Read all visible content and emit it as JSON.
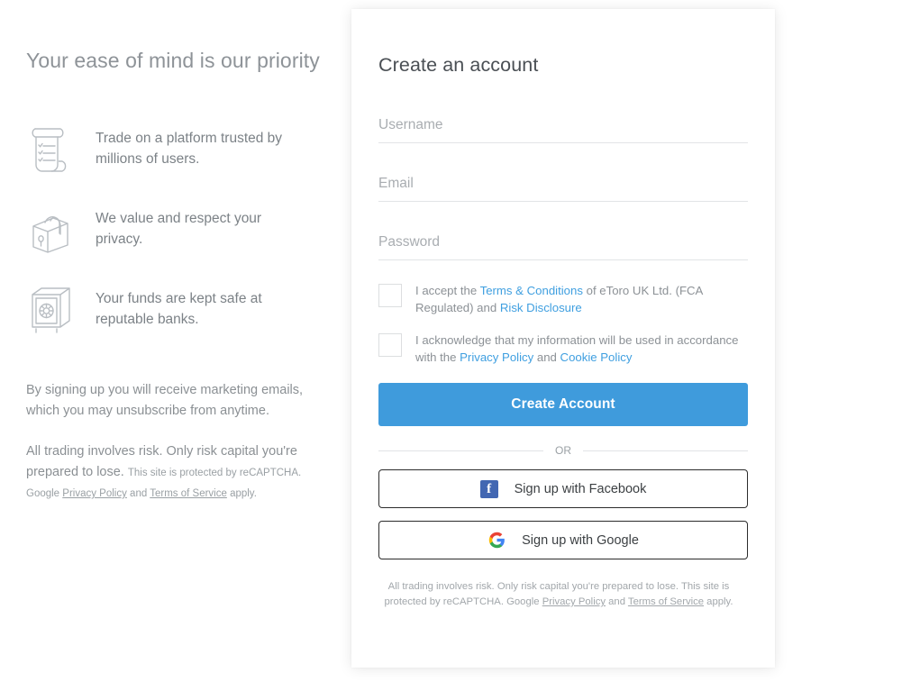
{
  "left": {
    "title": "Your ease of mind is our priority",
    "features": [
      {
        "icon": "scroll-checklist-icon",
        "text": "Trade on a platform trusted by millions of users."
      },
      {
        "icon": "padlock-icon",
        "text": "We value and respect your privacy."
      },
      {
        "icon": "safe-vault-icon",
        "text": "Your funds are kept safe at reputable banks."
      }
    ],
    "marketing_notice": "By signing up you will receive marketing emails, which you may unsubscribe from anytime.",
    "risk_notice": "All trading involves risk. Only risk capital you're prepared to lose.",
    "recaptcha": {
      "part1": "This site is protected by reCAPTCHA. Google ",
      "privacy_policy": "Privacy Policy",
      "and": " and ",
      "terms_of_service": "Terms of Service",
      "apply": " apply."
    }
  },
  "card": {
    "title": "Create an account",
    "fields": [
      {
        "name": "username",
        "placeholder": "Username",
        "value": "",
        "type": "text"
      },
      {
        "name": "email",
        "placeholder": "Email",
        "value": "",
        "type": "text"
      },
      {
        "name": "password",
        "placeholder": "Password",
        "value": "",
        "type": "password"
      }
    ],
    "consents": [
      {
        "checked": false,
        "p1": "I accept the ",
        "link1": "Terms & Conditions",
        "p2": " of eToro UK Ltd. (FCA Regulated) and ",
        "link2": "Risk Disclosure",
        "p3": ""
      },
      {
        "checked": false,
        "p1": "I acknowledge that my information will be used in accordance with the ",
        "link1": "Privacy Policy",
        "p2": " and ",
        "link2": "Cookie Policy",
        "p3": ""
      }
    ],
    "submit_label": "Create Account",
    "or_label": "OR",
    "social": [
      {
        "icon": "facebook-icon",
        "label": "Sign up with Facebook"
      },
      {
        "icon": "google-icon",
        "label": "Sign up with Google"
      }
    ],
    "footer": {
      "part1": "All trading involves risk. Only risk capital you're prepared to lose. This site is protected by reCAPTCHA. Google ",
      "privacy_policy": "Privacy Policy",
      "and": " and ",
      "terms_of_service": "Terms of Service",
      "apply": " apply."
    }
  },
  "colors": {
    "accent": "#3f9bdc",
    "link": "#3f9fe0",
    "facebook": "#4267b2",
    "google_blue": "#4285f4",
    "google_red": "#ea4335",
    "google_yellow": "#fbbc05",
    "google_green": "#34a853"
  }
}
